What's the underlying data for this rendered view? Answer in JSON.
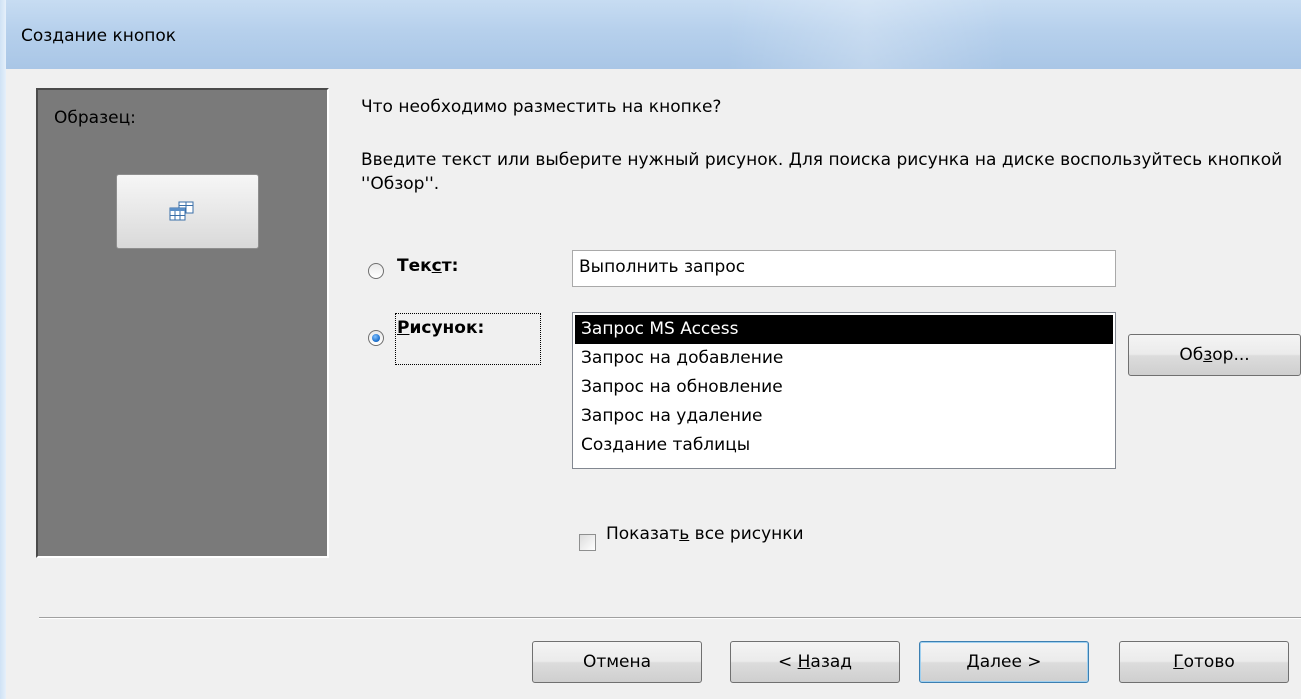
{
  "window": {
    "title": "Создание кнопок"
  },
  "sample": {
    "label": "Образец:",
    "button_icon": "query-datasheet-icon"
  },
  "prompt": {
    "question": "Что необходимо разместить на кнопке?",
    "instruction": "Введите текст или выберите нужный рисунок.  Для поиска рисунка на диске воспользуйтесь кнопкой ''Обзор''."
  },
  "options": {
    "text_option": {
      "label_before": "Тек",
      "label_accel": "с",
      "label_after": "т:",
      "selected": false
    },
    "picture_option": {
      "label_before": "",
      "label_accel": "Р",
      "label_after": "исунок:",
      "selected": true
    }
  },
  "text_input": {
    "value": "Выполнить запрос"
  },
  "picture_list": {
    "items": [
      "Запрос MS Access",
      "Запрос на добавление",
      "Запрос на обновление",
      "Запрос на удаление",
      "Создание таблицы"
    ],
    "selected_index": 0
  },
  "browse_button": {
    "label_before": "Об",
    "label_accel": "з",
    "label_after": "ор..."
  },
  "show_all_checkbox": {
    "label_before": "Показат",
    "label_accel": "ь",
    "label_after": " все рисунки",
    "checked": false
  },
  "footer": {
    "cancel": {
      "label_before": "Отмена",
      "label_accel": "",
      "label_after": ""
    },
    "back": {
      "label_before": "< ",
      "label_accel": "Н",
      "label_after": "азад"
    },
    "next": {
      "label_before": "",
      "label_accel": "Д",
      "label_after": "алее >"
    },
    "finish": {
      "label_before": "",
      "label_accel": "Г",
      "label_after": "отово"
    }
  },
  "colors": {
    "titlebar": "#b6d0ec",
    "dialog_bg": "#f0f0f0",
    "sample_panel": "#7a7a7a",
    "list_selection": "#000000",
    "default_button_border": "#3c7fb1"
  }
}
